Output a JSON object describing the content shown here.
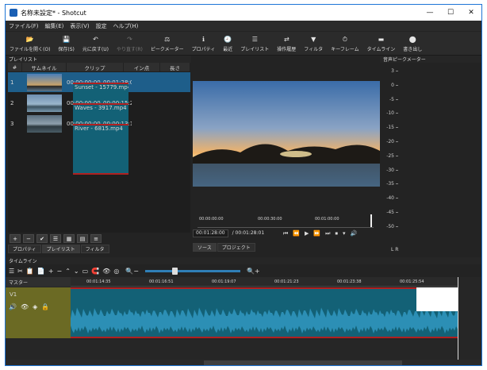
{
  "window": {
    "title": "名称未設定* - Shotcut",
    "controls": [
      "—",
      "☐",
      "✕"
    ]
  },
  "menu": [
    "ファイル(F)",
    "編集(E)",
    "表示(V)",
    "設定",
    "ヘルプ(H)"
  ],
  "toolbar": [
    {
      "label": "ファイルを開く(O)",
      "icon": "folder-open-icon",
      "glyph": "📂",
      "enabled": true
    },
    {
      "label": "保存(S)",
      "icon": "save-icon",
      "glyph": "💾",
      "enabled": true
    },
    {
      "label": "元に戻す(U)",
      "icon": "undo-icon",
      "glyph": "↶",
      "enabled": true
    },
    {
      "label": "やり直す(R)",
      "icon": "redo-icon",
      "glyph": "↷",
      "enabled": false
    },
    {
      "label": "ピークメーター",
      "icon": "peak-meter-icon",
      "glyph": "⚖",
      "enabled": true
    },
    {
      "label": "プロパティ",
      "icon": "properties-icon",
      "glyph": "ℹ",
      "enabled": true
    },
    {
      "label": "最近",
      "icon": "recent-icon",
      "glyph": "🕘",
      "enabled": true
    },
    {
      "label": "プレイリスト",
      "icon": "playlist-icon",
      "glyph": "☰",
      "enabled": true
    },
    {
      "label": "操作履歴",
      "icon": "history-icon",
      "glyph": "⇄",
      "enabled": true
    },
    {
      "label": "フィルタ",
      "icon": "filter-icon",
      "glyph": "▼",
      "enabled": true
    },
    {
      "label": "キーフレーム",
      "icon": "keyframe-icon",
      "glyph": "⏱",
      "enabled": true
    },
    {
      "label": "タイムライン",
      "icon": "timeline-icon",
      "glyph": "▬",
      "enabled": true
    },
    {
      "label": "書き出し",
      "icon": "export-icon",
      "glyph": "⬤",
      "enabled": true
    }
  ],
  "playlist": {
    "title": "プレイリスト",
    "columns": [
      "#",
      "サムネイル",
      "クリップ",
      "イン点",
      "長さ"
    ],
    "rows": [
      {
        "num": "1",
        "clip": "Sunset - 15779.mp4",
        "in": "00:00:00:00",
        "len": "00:01:28:0",
        "selected": true
      },
      {
        "num": "2",
        "clip": "Waves - 3917.mp4",
        "in": "00:00:00:00",
        "len": "00:00:15:2",
        "selected": false
      },
      {
        "num": "3",
        "clip": "River - 6815.mp4",
        "in": "00:00:00:00",
        "len": "00:00:13:1",
        "selected": false
      }
    ],
    "buttons": [
      "+",
      "−",
      "✔",
      "☰",
      "▦",
      "▤",
      "≡"
    ],
    "tabs": [
      "プロパティ",
      "プレイリスト",
      "フィルタ"
    ]
  },
  "player": {
    "ruler_ticks": [
      "00:00:00:00",
      "00:00:30:00",
      "00:01:00:00"
    ],
    "position": "00:01:28:00",
    "duration": "/ 00:01:28:01",
    "transport": [
      "⏮",
      "⏪",
      "▶",
      "⏩",
      "⏭",
      "⏹",
      "▾",
      "🔊"
    ],
    "tabs": [
      "ソース",
      "プロジェクト"
    ]
  },
  "meter": {
    "title": "音声ピークメーター",
    "scale": [
      "3",
      "0",
      "-5",
      "-10",
      "-15",
      "-20",
      "-25",
      "-30",
      "-35",
      "-40",
      "-45",
      "-50"
    ],
    "channels": "L  R"
  },
  "timeline": {
    "title": "タイムライン",
    "tools": [
      "☰",
      "✂",
      "📋",
      "📄",
      "+",
      "−",
      "⌃",
      "⌄",
      "▭",
      "🧲",
      "👁",
      "◎",
      "🔍−",
      "🔍+"
    ],
    "master": "マスター",
    "ticks": [
      "00:01:14:35",
      "00:01:16:51",
      "00:01:19:07",
      "00:01:21:23",
      "00:01:23:38",
      "00:01:25:54"
    ],
    "track": "V1"
  }
}
